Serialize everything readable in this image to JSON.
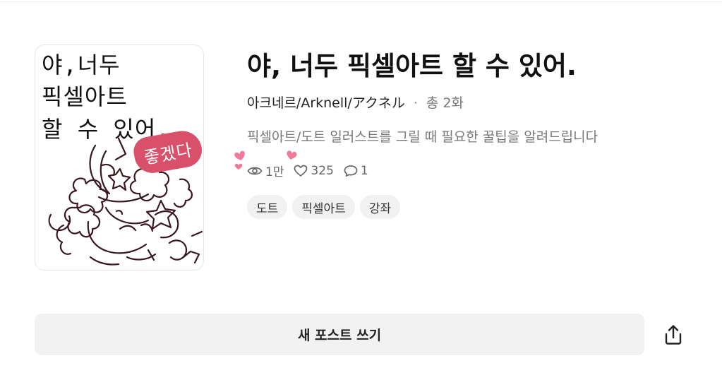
{
  "book": {
    "cover": {
      "title_line1": "야,너두",
      "title_line2": "픽셀아트",
      "title_line3": "할 수 있어.",
      "badge": "좋겠다"
    },
    "title": "야, 너두 픽셀아트 할 수 있어.",
    "author": "아크네르/Arknell/アクネル",
    "separator": "·",
    "episode_count": "총 2화",
    "description": "픽셀아트/도트 일러스트를 그릴 때 필요한 꿀팁을 알려드립니다",
    "stats": {
      "views": "1만",
      "likes": "325",
      "comments": "1"
    },
    "tags": [
      "도트",
      "픽셀아트",
      "강좌"
    ]
  },
  "actions": {
    "new_post_label": "새 포스트 쓰기",
    "share_icon": "share-icon"
  },
  "colors": {
    "accent_pink": "#d9506b",
    "muted_text": "#777777",
    "chip_bg": "#f1f1f1"
  }
}
